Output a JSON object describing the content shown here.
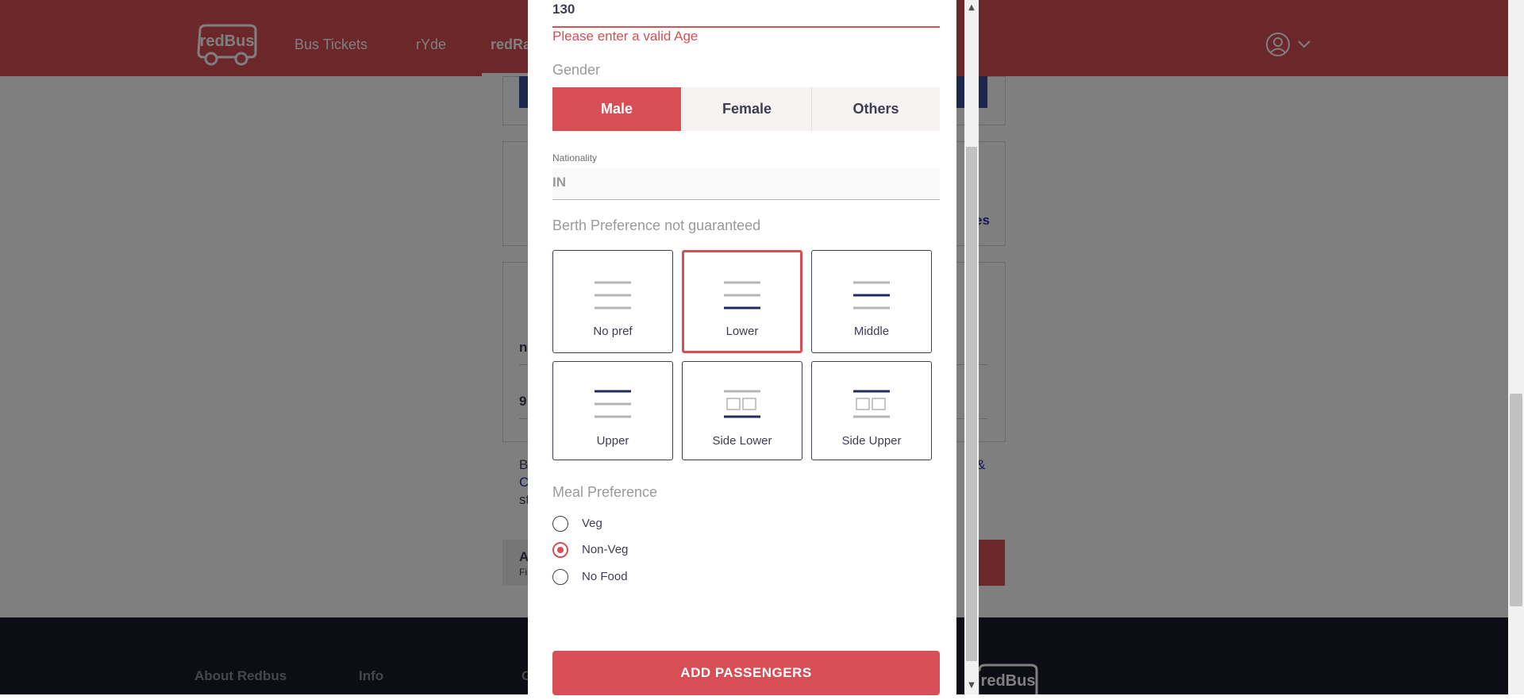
{
  "header": {
    "logo_text": "redBus",
    "nav": [
      "Bus Tickets",
      "rYde",
      "redRail"
    ]
  },
  "background": {
    "fragments": [
      "n",
      "9",
      "B",
      "C",
      "st",
      "A",
      "Fi",
      "es",
      "&"
    ]
  },
  "footer": {
    "links": [
      "About Redbus",
      "Info",
      "G"
    ],
    "logo_text": "redBus"
  },
  "modal": {
    "age_value": "130",
    "age_error": "Please enter a valid Age",
    "gender_label": "Gender",
    "gender_options": [
      "Male",
      "Female",
      "Others"
    ],
    "gender_selected": "Male",
    "nationality_label": "Nationality",
    "nationality_value": "IN",
    "berth_label": "Berth Preference not guaranteed",
    "berth_options": [
      "No pref",
      "Lower",
      "Middle",
      "Upper",
      "Side Lower",
      "Side Upper"
    ],
    "berth_selected": "Lower",
    "meal_label": "Meal Preference",
    "meal_options": [
      "Veg",
      "Non-Veg",
      "No Food"
    ],
    "meal_selected": "Non-Veg",
    "add_button": "ADD PASSENGERS"
  },
  "colors": {
    "brand_red": "#d84e55",
    "navy": "#1e2d5e",
    "line_grey": "#b4b4b4",
    "footer_bg": "#1a1d2b"
  }
}
